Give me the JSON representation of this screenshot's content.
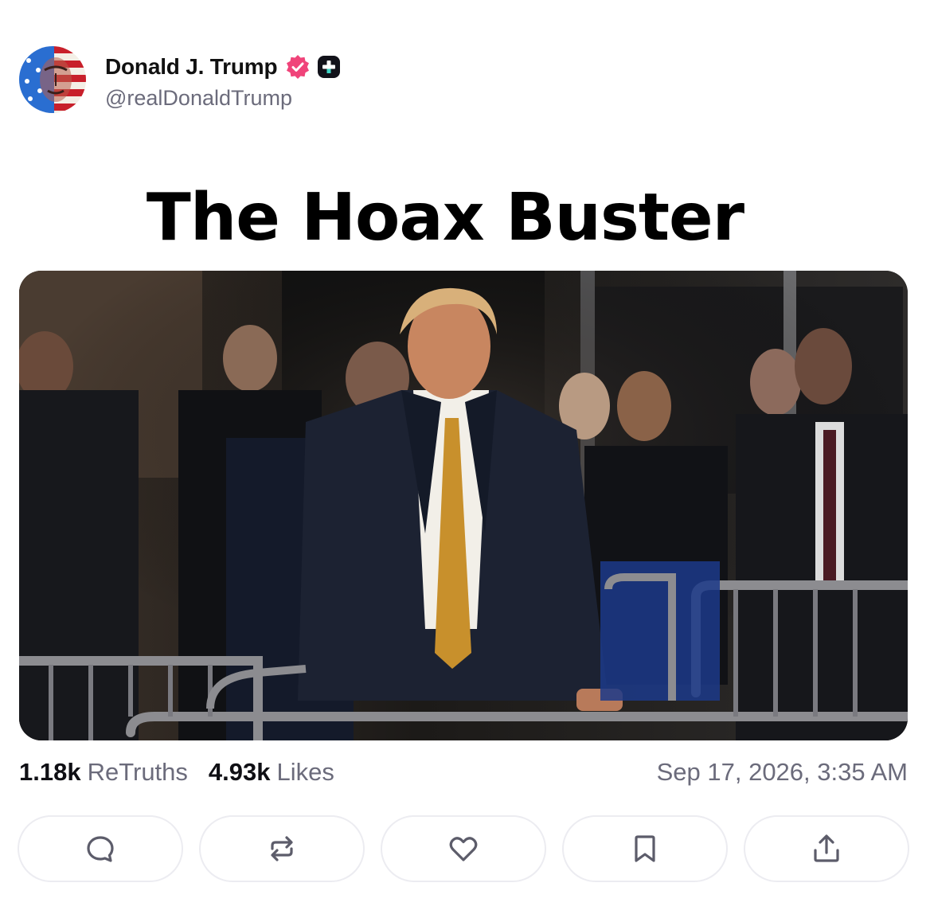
{
  "post": {
    "author": {
      "display_name": "Donald J. Trump",
      "handle": "@realDonaldTrump",
      "avatar_icon": "flag-portrait-avatar",
      "verified_icon": "verified-badge-icon",
      "verified_color": "#f0447a",
      "plus_icon": "plus-badge-icon"
    },
    "media": {
      "title_text": "The Hoax Buster"
    },
    "stats": {
      "retruths_count": "1.18k",
      "retruths_label": "ReTruths",
      "likes_count": "4.93k",
      "likes_label": "Likes",
      "timestamp": "Sep 17, 2026, 3:35 AM"
    },
    "actions": [
      {
        "name": "reply",
        "icon": "comment-icon"
      },
      {
        "name": "retruth",
        "icon": "repost-icon"
      },
      {
        "name": "like",
        "icon": "heart-icon"
      },
      {
        "name": "bookmark",
        "icon": "bookmark-icon"
      },
      {
        "name": "share",
        "icon": "share-icon"
      }
    ]
  }
}
